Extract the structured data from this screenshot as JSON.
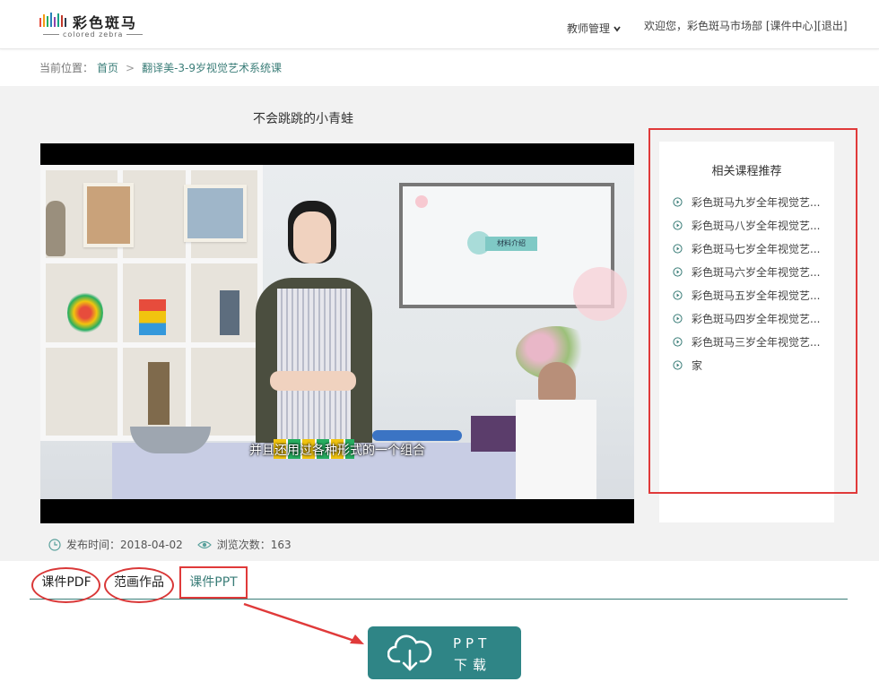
{
  "header": {
    "logo_name": "彩色斑马",
    "logo_sub": "colored zebra",
    "nav_teacher": "教师管理",
    "welcome": "欢迎您，彩色斑马市场部  [课件中心][退出]"
  },
  "breadcrumb": {
    "prefix": "当前位置：",
    "home": "首页",
    "current": "翻译美-3-9岁视觉艺术系统课"
  },
  "video": {
    "title": "不会跳跳的小青蛙",
    "subtitle": "并且还用过各种形式的一个组合",
    "board_label": "材料介绍"
  },
  "meta": {
    "publish_label": "发布时间：",
    "publish_date": "2018-04-02",
    "views_label": "浏览次数：",
    "views": "163"
  },
  "recommend": {
    "title": "相关课程推荐",
    "items": [
      "彩色斑马九岁全年视觉艺...",
      "彩色斑马八岁全年视觉艺...",
      "彩色斑马七岁全年视觉艺...",
      "彩色斑马六岁全年视觉艺...",
      "彩色斑马五岁全年视觉艺...",
      "彩色斑马四岁全年视觉艺...",
      "彩色斑马三岁全年视觉艺...",
      "家"
    ]
  },
  "tabs": [
    "课件PDF",
    "范画作品",
    "课件PPT"
  ],
  "download": {
    "line1": "PPT",
    "line2": "下载"
  },
  "colors": {
    "accent": "#3a7d78",
    "button": "#2f8586",
    "annotation_red": "#e03a3a"
  }
}
